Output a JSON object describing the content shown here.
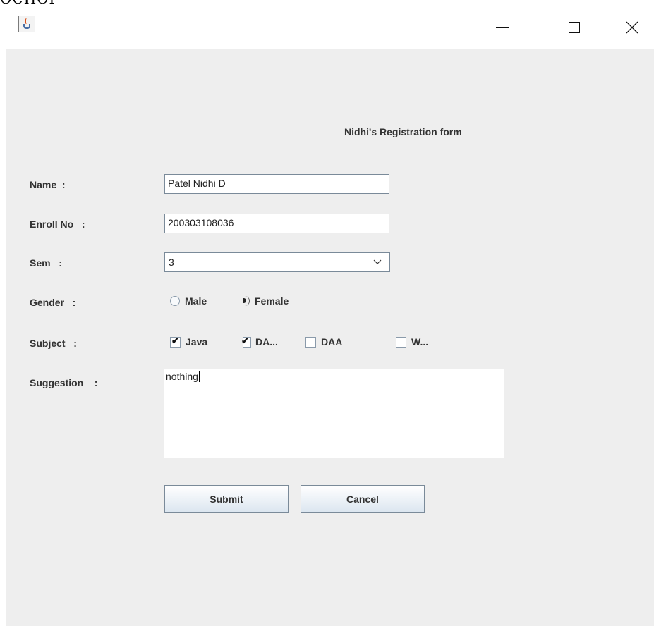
{
  "window": {
    "clipped_text_top": "ОСНОГ"
  },
  "form": {
    "title": "Nidhi's Registration form",
    "name_label": "Name  :",
    "name_value": "Patel Nidhi D",
    "enroll_label": "Enroll No   :",
    "enroll_value": "200303108036",
    "sem_label": "Sem   :",
    "sem_value": "3",
    "gender_label": "Gender   :",
    "gender_options": [
      {
        "label": "Male",
        "selected": false
      },
      {
        "label": "Female",
        "selected": true
      }
    ],
    "subject_label": "Subject   :",
    "subject_options": [
      {
        "label": "Java",
        "checked": true
      },
      {
        "label": "DA...",
        "checked": true
      },
      {
        "label": "DAA",
        "checked": false
      },
      {
        "label": "W...",
        "checked": false
      }
    ],
    "suggestion_label": "Suggestion    :",
    "suggestion_value": "nothing",
    "submit_label": "Submit",
    "cancel_label": "Cancel"
  },
  "icons": {
    "app": "java-cup-icon",
    "minimize": "minimize-icon",
    "maximize": "maximize-icon",
    "close": "close-icon",
    "dropdown": "chevron-down-icon"
  }
}
